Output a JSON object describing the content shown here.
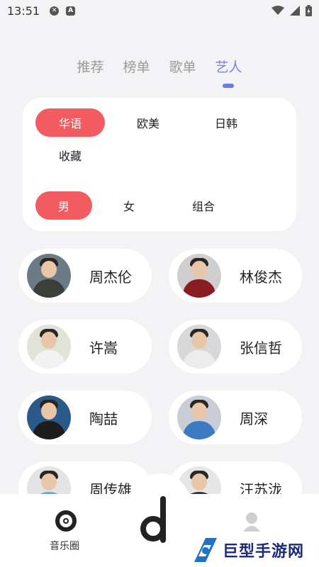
{
  "status_bar": {
    "time": "13:51"
  },
  "tabs": [
    {
      "label": "推荐",
      "active": false
    },
    {
      "label": "榜单",
      "active": false
    },
    {
      "label": "歌单",
      "active": false
    },
    {
      "label": "艺人",
      "active": true
    }
  ],
  "filters": {
    "region": [
      {
        "label": "华语",
        "active": true
      },
      {
        "label": "欧美",
        "active": false
      },
      {
        "label": "日韩",
        "active": false
      },
      {
        "label": "收藏",
        "active": false
      }
    ],
    "gender": [
      {
        "label": "男",
        "active": true
      },
      {
        "label": "女",
        "active": false
      },
      {
        "label": "组合",
        "active": false
      }
    ]
  },
  "artists": [
    {
      "name": "周杰伦"
    },
    {
      "name": "林俊杰"
    },
    {
      "name": "许嵩"
    },
    {
      "name": "张信哲"
    },
    {
      "name": "陶喆"
    },
    {
      "name": "周深"
    },
    {
      "name": "周传雄"
    },
    {
      "name": "汪苏泷"
    }
  ],
  "bottom_nav": {
    "items": [
      {
        "label": "音乐圈",
        "icon": "disc-icon"
      },
      {
        "label": "",
        "icon": "d-logo-icon"
      },
      {
        "label": "",
        "icon": "person-icon"
      }
    ]
  },
  "watermark": {
    "text": "巨型手游网"
  },
  "colors": {
    "accent_red": "#f25b60",
    "tab_active": "#7a82e6",
    "background": "#f3f3f5"
  }
}
